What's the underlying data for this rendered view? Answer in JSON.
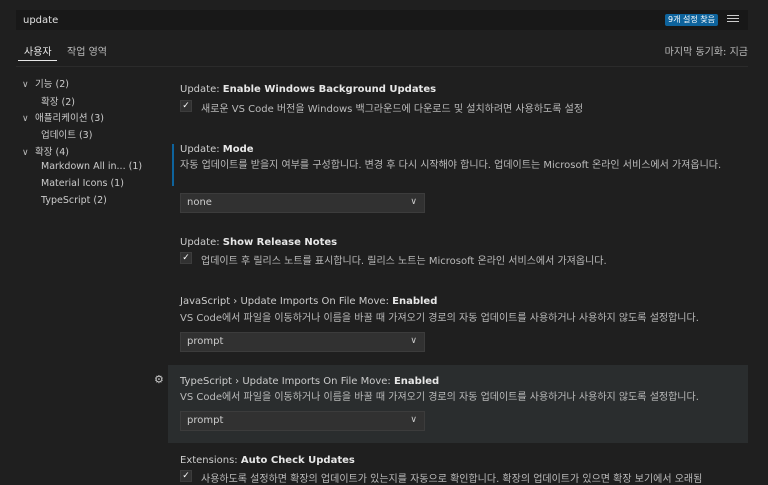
{
  "search": {
    "value": "update",
    "result_badge": "9개 설정 찾음",
    "filter_icon": "filter-list-icon"
  },
  "tabs": [
    {
      "label": "사용자"
    },
    {
      "label": "작업 영역"
    }
  ],
  "sync_status": "마지막 동기화: 지금",
  "toc": [
    {
      "label": "기능 (2)"
    },
    {
      "label": "확장 (2)"
    },
    {
      "label": "애플리케이션 (3)"
    },
    {
      "label": "업데이트 (3)"
    },
    {
      "label": "확장 (4)"
    },
    {
      "label": "Markdown All in... (1)"
    },
    {
      "label": "Material Icons (1)"
    },
    {
      "label": "TypeScript (2)"
    }
  ],
  "settings": [
    {
      "category": "Update: ",
      "name": "Enable Windows Background Updates",
      "checked": true,
      "description": "새로운 VS Code 버전을 Windows 백그라운드에 다운로드 및 설치하려면 사용하도록 설정"
    },
    {
      "category": "Update: ",
      "name": "Mode",
      "description": "자동 업데이트를 받을지 여부를 구성합니다. 변경 후 다시 시작해야 합니다. 업데이트는 Microsoft 온라인 서비스에서 가져옵니다.",
      "value": "none"
    },
    {
      "category": "Update: ",
      "name": "Show Release Notes",
      "checked": true,
      "description": "업데이트 후 릴리스 노트를 표시합니다. 릴리스 노트는 Microsoft 온라인 서비스에서 가져옵니다."
    },
    {
      "category": "JavaScript › Update Imports On File Move: ",
      "name": "Enabled",
      "description": "VS Code에서 파일을 이동하거나 이름을 바꿀 때 가져오기 경로의 자동 업데이트를 사용하거나 사용하지 않도록 설정합니다.",
      "value": "prompt"
    },
    {
      "category": "TypeScript › Update Imports On File Move: ",
      "name": "Enabled",
      "description": "VS Code에서 파일을 이동하거나 이름을 바꿀 때 가져오기 경로의 자동 업데이트를 사용하거나 사용하지 않도록 설정합니다.",
      "value": "prompt"
    },
    {
      "category": "Extensions: ",
      "name": "Auto Check Updates",
      "checked": true,
      "description": "사용하도록 설정하면 확장의 업데이트가 있는지를 자동으로 확인합니다. 확장의 업데이트가 있으면 확장 보기에서 오래됨"
    }
  ]
}
